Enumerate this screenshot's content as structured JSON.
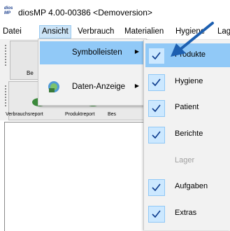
{
  "window": {
    "icon_text_top": "dios",
    "icon_text_bottom": "MP",
    "title": "diosMP  4.00-00386 <Demoversion>"
  },
  "menubar": {
    "items": [
      "Datei",
      "Ansicht",
      "Verbrauch",
      "Materialien",
      "Hygiene",
      "Lag"
    ]
  },
  "toolbar": {
    "row1_label": "Be",
    "row2_labels": [
      "Verbrauchsreport",
      "Produktreport",
      "Bes"
    ]
  },
  "ansicht_menu": {
    "items": [
      {
        "label": "Symbolleisten",
        "icon": "none",
        "submenu": true
      },
      {
        "label": "Daten-Anzeige",
        "icon": "data-display-icon",
        "submenu": true
      }
    ]
  },
  "symbolleisten_submenu": {
    "items": [
      {
        "label": "Produkte",
        "checked": true,
        "enabled": true
      },
      {
        "label": "Hygiene",
        "checked": true,
        "enabled": true
      },
      {
        "label": "Patient",
        "checked": true,
        "enabled": true
      },
      {
        "label": "Berichte",
        "checked": true,
        "enabled": true
      },
      {
        "label": "Lager",
        "checked": false,
        "enabled": false
      },
      {
        "label": "Aufgaben",
        "checked": true,
        "enabled": true
      },
      {
        "label": "Extras",
        "checked": true,
        "enabled": true
      }
    ]
  },
  "colors": {
    "highlight": "#91c9f7",
    "check": "#0b3a8c",
    "annotation_arrow": "#1d5fb0"
  }
}
